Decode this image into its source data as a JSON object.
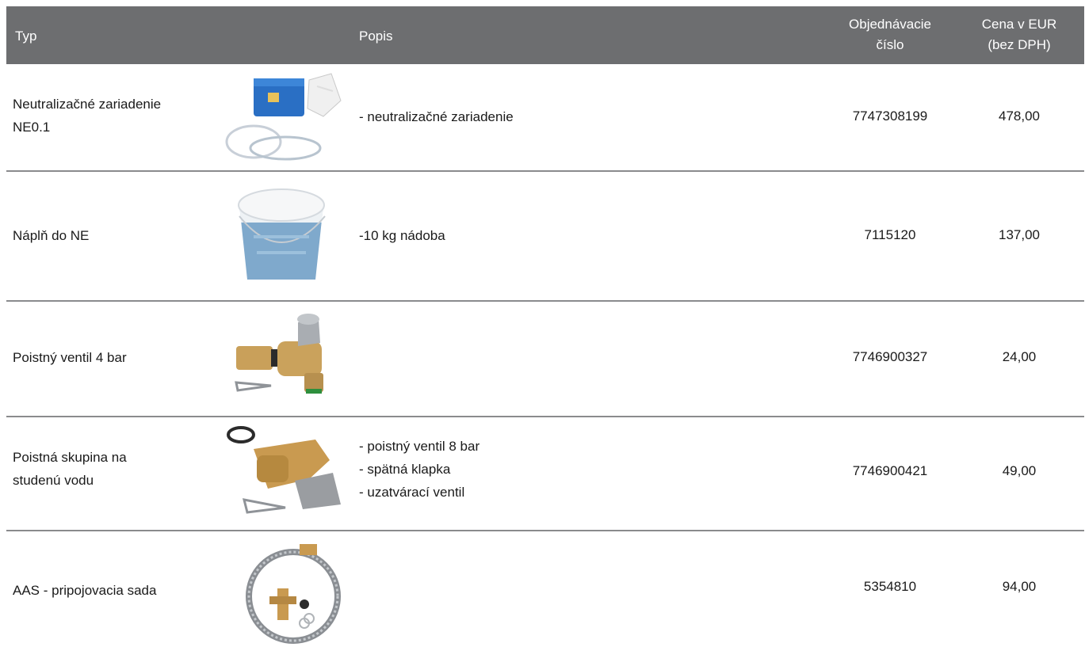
{
  "header": {
    "typ": "Typ",
    "popis": "Popis",
    "objednavacie_line1": "Objednávacie",
    "objednavacie_line2": "číslo",
    "cena_line1": "Cena v EUR",
    "cena_line2": "(bez DPH)"
  },
  "rows": [
    {
      "typ_line1": "Neutralizačné zariadenie",
      "typ_line2": "NE0.1",
      "desc": [
        "- neutralizačné zariadenie"
      ],
      "order_number": "7747308199",
      "price": "478,00",
      "image_icon": "neutralization-unit-icon"
    },
    {
      "typ_line1": "Náplň do NE",
      "desc": [
        "-10 kg nádoba"
      ],
      "order_number": "7115120",
      "price": "137,00",
      "image_icon": "bucket-icon"
    },
    {
      "typ_line1": "Poistný ventil 4 bar",
      "desc": [],
      "order_number": "7746900327",
      "price": "24,00",
      "image_icon": "safety-valve-icon"
    },
    {
      "typ_line1": "Poistná skupina na",
      "typ_line2": "studenú vodu",
      "desc": [
        "- poistný ventil 8 bar",
        "- spätná klapka",
        "- uzatvárací ventil"
      ],
      "order_number": "7746900421",
      "price": "49,00",
      "image_icon": "safety-group-icon"
    },
    {
      "typ_line1": "AAS - pripojovacia sada",
      "desc": [],
      "order_number": "5354810",
      "price": "94,00",
      "image_icon": "connection-hose-icon"
    }
  ],
  "colors": {
    "header_bg": "#6d6e70",
    "header_text": "#ffffff",
    "row_divider": "#8a8b8d",
    "body_text": "#1a1a1a"
  }
}
